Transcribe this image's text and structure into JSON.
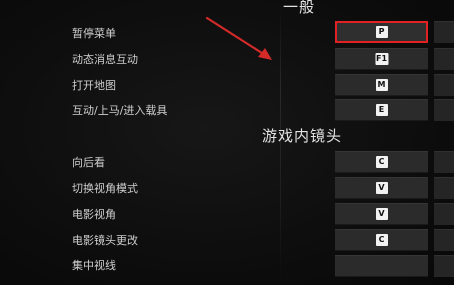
{
  "sections": {
    "general": "一般",
    "camera": "游戏内镜头"
  },
  "rows": [
    {
      "label": "暂停菜单",
      "key": "P"
    },
    {
      "label": "动态消息互动",
      "key": "F1"
    },
    {
      "label": "打开地图",
      "key": "M"
    },
    {
      "label": "互动/上马/进入载具",
      "key": "E"
    },
    {
      "label": "向后看",
      "key": "C"
    },
    {
      "label": "切换视角模式",
      "key": "V"
    },
    {
      "label": "电影视角",
      "key": "V"
    },
    {
      "label": "电影镜头更改",
      "key": "C"
    },
    {
      "label": "集中视线",
      "key": ""
    }
  ],
  "colors": {
    "highlight": "#e02222",
    "arrow": "#d42a2a"
  }
}
